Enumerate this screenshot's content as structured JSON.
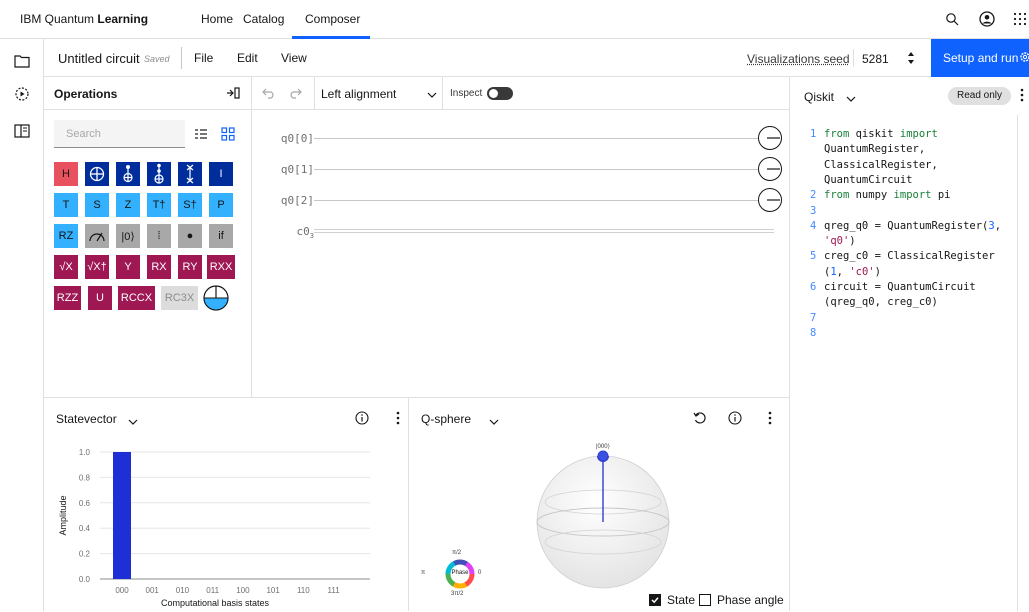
{
  "topnav": {
    "brand_prefix": "IBM Quantum ",
    "brand_bold": "Learning",
    "links": [
      "Home",
      "Catalog",
      "Composer"
    ]
  },
  "toolbar": {
    "title": "Untitled circuit",
    "saved": "Saved",
    "menus": [
      "File",
      "Edit",
      "View"
    ],
    "vis_seed_label": "Visualizations seed",
    "seed_value": "5281",
    "run_label": "Setup and run"
  },
  "operations": {
    "title": "Operations",
    "search_placeholder": "Search",
    "gates": [
      [
        "H",
        "⊕",
        "⊕̇",
        "⊕̈",
        "✕",
        "I"
      ],
      [
        "T",
        "S",
        "Z",
        "T†",
        "S†",
        "P"
      ],
      [
        "RZ",
        "↗",
        "|0⟩",
        "⁞",
        "●",
        "if"
      ],
      [
        "√X",
        "√X†",
        "Y",
        "RX",
        "RY",
        "RXX"
      ],
      [
        "RZZ",
        "U",
        "RCCX",
        "RC3X"
      ]
    ]
  },
  "circuit": {
    "alignment": "Left alignment",
    "inspect": "Inspect",
    "qubits": [
      "q0[0]",
      "q0[1]",
      "q0[2]"
    ],
    "classical": "c0",
    "classical_count": "3"
  },
  "code": {
    "language": "Qiskit",
    "badge": "Read only",
    "lines": [
      {
        "n": "1",
        "parts": [
          [
            "kw",
            "from "
          ],
          [
            "",
            "qiskit "
          ],
          [
            "kw",
            "import"
          ]
        ]
      },
      {
        "n": "",
        "parts": [
          [
            "",
            "QuantumRegister,"
          ]
        ]
      },
      {
        "n": "",
        "parts": [
          [
            "",
            "ClassicalRegister,"
          ]
        ]
      },
      {
        "n": "",
        "parts": [
          [
            "",
            "QuantumCircuit"
          ]
        ]
      },
      {
        "n": "2",
        "parts": [
          [
            "kw",
            "from "
          ],
          [
            "",
            "numpy "
          ],
          [
            "kw",
            "import "
          ],
          [
            "",
            "pi"
          ]
        ]
      },
      {
        "n": "3",
        "parts": []
      },
      {
        "n": "4",
        "parts": [
          [
            "",
            "qreg_q0 = QuantumRegister("
          ],
          [
            "num",
            "3"
          ],
          [
            "",
            ","
          ]
        ]
      },
      {
        "n": "",
        "parts": [
          [
            "str",
            "'q0'"
          ],
          [
            "",
            ")"
          ]
        ]
      },
      {
        "n": "5",
        "parts": [
          [
            "",
            "creg_c0 = ClassicalRegister"
          ]
        ]
      },
      {
        "n": "",
        "parts": [
          [
            "",
            "("
          ],
          [
            "num",
            "1"
          ],
          [
            "",
            ", "
          ],
          [
            "str",
            "'c0'"
          ],
          [
            "",
            ")"
          ]
        ]
      },
      {
        "n": "6",
        "parts": [
          [
            "",
            "circuit = QuantumCircuit"
          ]
        ]
      },
      {
        "n": "",
        "parts": [
          [
            "",
            "(qreg_q0, creg_c0)"
          ]
        ]
      },
      {
        "n": "7",
        "parts": []
      },
      {
        "n": "8",
        "parts": []
      }
    ]
  },
  "statevector": {
    "title": "Statevector"
  },
  "chart_data": {
    "type": "bar",
    "categories": [
      "000",
      "001",
      "010",
      "011",
      "100",
      "101",
      "110",
      "111"
    ],
    "values": [
      1.0,
      0,
      0,
      0,
      0,
      0,
      0,
      0
    ],
    "xlabel": "Computational basis states",
    "ylabel": "Amplitude",
    "ylim": [
      0,
      1.0
    ],
    "yticks": [
      "0.0",
      "0.2",
      "0.4",
      "0.6",
      "0.8",
      "1.0"
    ],
    "grid": true,
    "color": "#1f2fd6"
  },
  "qsphere": {
    "title": "Q-sphere",
    "state_label": "|000⟩",
    "phase_label": "Phase",
    "phase_top": "π/2",
    "phase_left": "π",
    "phase_right": "0",
    "phase_bottom": "3π/2",
    "state_check": "State",
    "phase_check": "Phase angle"
  },
  "colors": {
    "accent": "#0f62fe"
  }
}
